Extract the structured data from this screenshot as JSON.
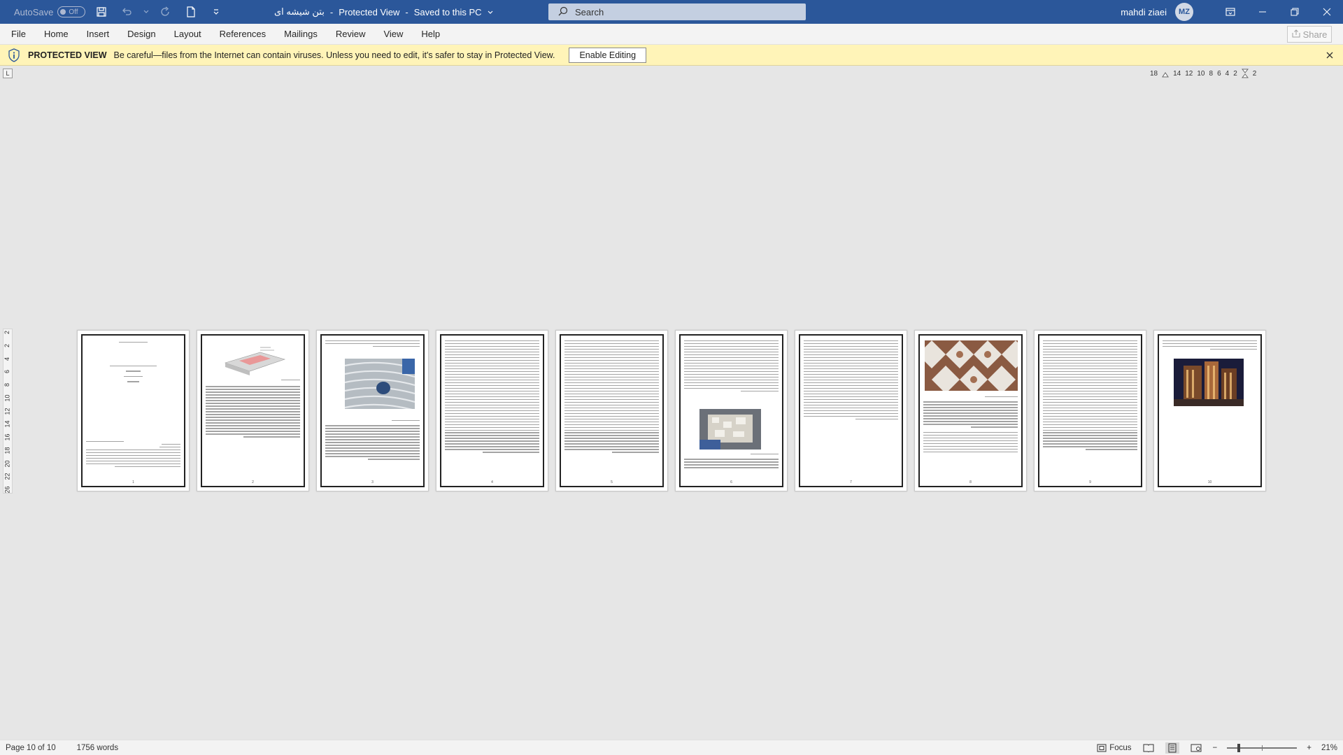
{
  "titlebar": {
    "autosave_label": "AutoSave",
    "autosave_state": "Off",
    "doc_name": "بتن شیشه ای",
    "separator": "-",
    "view_mode": "Protected View",
    "save_state": "Saved to this PC",
    "search_placeholder": "Search",
    "user_name": "mahdi ziaei",
    "user_initials": "MZ"
  },
  "ribbon": {
    "tabs": [
      "File",
      "Home",
      "Insert",
      "Design",
      "Layout",
      "References",
      "Mailings",
      "Review",
      "View",
      "Help"
    ],
    "share_label": "Share"
  },
  "protected_bar": {
    "title": "PROTECTED VIEW",
    "message": "Be careful—files from the Internet can contain viruses. Unless you need to edit, it's safer to stay in Protected View.",
    "enable_label": "Enable Editing"
  },
  "ruler": {
    "corner": "L",
    "horizontal_ticks": [
      "18",
      "14",
      "12",
      "10",
      "8",
      "6",
      "4",
      "2",
      "2"
    ],
    "vertical_ticks": [
      "2",
      "2",
      "4",
      "6",
      "8",
      "10",
      "12",
      "14",
      "16",
      "18",
      "20",
      "22",
      "26"
    ]
  },
  "status": {
    "page_info": "Page 10 of 10",
    "word_count": "1756 words",
    "focus_label": "Focus",
    "zoom_minus": "−",
    "zoom_plus": "+",
    "zoom_level": "21%"
  },
  "colors": {
    "titlebar": "#2b579a",
    "protected_bar": "#fff4b8",
    "ribbon": "#f3f3f3"
  }
}
